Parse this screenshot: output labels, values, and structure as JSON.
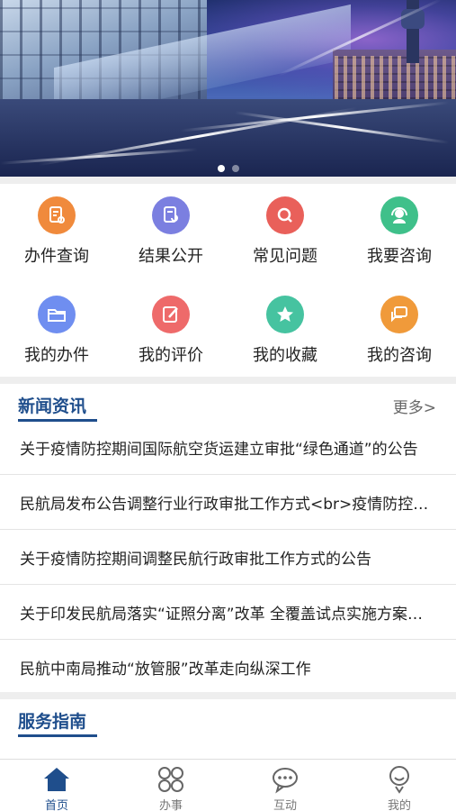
{
  "banner": {
    "slide_count": 2,
    "active_slide": 1
  },
  "colors": {
    "accent": "#1f4e8c",
    "orange": "#f08a3c",
    "purple": "#7b7fe0",
    "red": "#e9605a",
    "green": "#3fc08a",
    "blue": "#6f8ef0",
    "pink": "#ee6a6a",
    "teal": "#46c3a0",
    "amber": "#f09a3a"
  },
  "quick_actions": [
    {
      "label": "办件查询",
      "icon": "document-search-icon"
    },
    {
      "label": "结果公开",
      "icon": "document-refresh-icon"
    },
    {
      "label": "常见问题",
      "icon": "faq-search-icon"
    },
    {
      "label": "我要咨询",
      "icon": "headset-icon"
    },
    {
      "label": "我的办件",
      "icon": "folder-icon"
    },
    {
      "label": "我的评价",
      "icon": "edit-icon"
    },
    {
      "label": "我的收藏",
      "icon": "star-icon"
    },
    {
      "label": "我的咨询",
      "icon": "chat-icon"
    }
  ],
  "news": {
    "title": "新闻资讯",
    "more": "更多>",
    "items": [
      "关于疫情防控期间国际航空货运建立审批“绿色通道”的公告",
      "民航局发布公告调整行业行政审批工作方式<br>疫情防控期间",
      "关于疫情防控期间调整民航行政审批工作方式的公告",
      "关于印发民航局落实“证照分离”改革 全覆盖试点实施方案的通知",
      "民航中南局推动“放管服”改革走向纵深工作"
    ]
  },
  "guide": {
    "title": "服务指南"
  },
  "tabs": [
    {
      "label": "首页",
      "icon": "home-icon",
      "active": true
    },
    {
      "label": "办事",
      "icon": "grid-icon",
      "active": false
    },
    {
      "label": "互动",
      "icon": "chat-bubble-icon",
      "active": false
    },
    {
      "label": "我的",
      "icon": "user-icon",
      "active": false
    }
  ]
}
